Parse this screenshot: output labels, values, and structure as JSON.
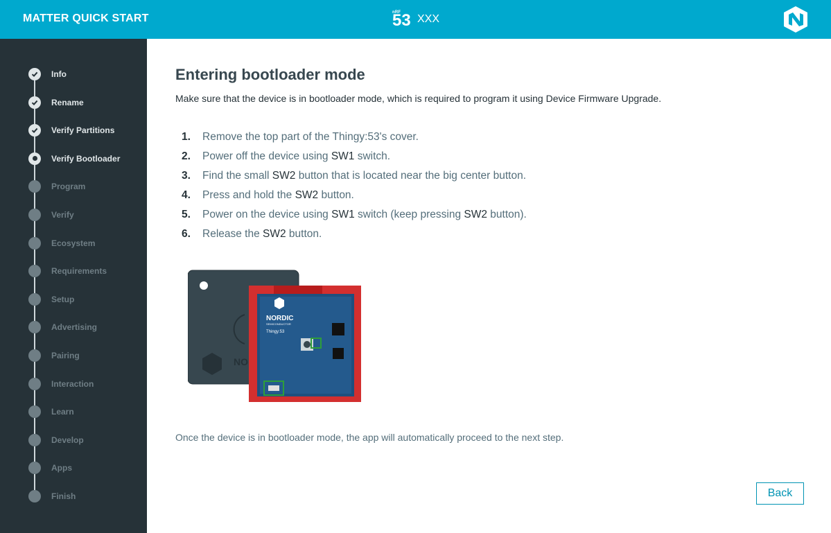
{
  "header": {
    "app_title": "MATTER QUICK START",
    "device_badge_small": "nRF",
    "device_badge_number": "53",
    "device_name": "XXX",
    "logo_icon": "nordic-logo-icon"
  },
  "sidebar": {
    "steps": [
      {
        "label": "Info",
        "state": "done"
      },
      {
        "label": "Rename",
        "state": "done"
      },
      {
        "label": "Verify Partitions",
        "state": "done"
      },
      {
        "label": "Verify Bootloader",
        "state": "active"
      },
      {
        "label": "Program",
        "state": "todo"
      },
      {
        "label": "Verify",
        "state": "todo"
      },
      {
        "label": "Ecosystem",
        "state": "todo"
      },
      {
        "label": "Requirements",
        "state": "todo"
      },
      {
        "label": "Setup",
        "state": "todo"
      },
      {
        "label": "Advertising",
        "state": "todo"
      },
      {
        "label": "Pairing",
        "state": "todo"
      },
      {
        "label": "Interaction",
        "state": "todo"
      },
      {
        "label": "Learn",
        "state": "todo"
      },
      {
        "label": "Develop",
        "state": "todo"
      },
      {
        "label": "Apps",
        "state": "todo"
      },
      {
        "label": "Finish",
        "state": "todo"
      }
    ]
  },
  "main": {
    "title": "Entering bootloader mode",
    "intro": "Make sure that the device is in bootloader mode, which is required to program it using Device Firmware Upgrade.",
    "instructions": [
      {
        "num": "1.",
        "parts": [
          {
            "t": "Remove the top part of the Thingy:53's cover.",
            "b": false
          }
        ]
      },
      {
        "num": "2.",
        "parts": [
          {
            "t": "Power off the device using ",
            "b": false
          },
          {
            "t": "SW1",
            "b": true
          },
          {
            "t": " switch.",
            "b": false
          }
        ]
      },
      {
        "num": "3.",
        "parts": [
          {
            "t": "Find the small ",
            "b": false
          },
          {
            "t": "SW2",
            "b": true
          },
          {
            "t": " button that is located near the big center button.",
            "b": false
          }
        ]
      },
      {
        "num": "4.",
        "parts": [
          {
            "t": "Press and hold the ",
            "b": false
          },
          {
            "t": "SW2",
            "b": true
          },
          {
            "t": " button.",
            "b": false
          }
        ]
      },
      {
        "num": "5.",
        "parts": [
          {
            "t": "Power on the device using ",
            "b": false
          },
          {
            "t": "SW1",
            "b": true
          },
          {
            "t": " switch (keep pressing ",
            "b": false
          },
          {
            "t": "SW2",
            "b": true
          },
          {
            "t": " button).",
            "b": false
          }
        ]
      },
      {
        "num": "6.",
        "parts": [
          {
            "t": "Release the ",
            "b": false
          },
          {
            "t": "SW2",
            "b": true
          },
          {
            "t": " button.",
            "b": false
          }
        ]
      }
    ],
    "image_text": {
      "brand": "NORDIC",
      "brand_sub": "SEMICONDUCTOR",
      "board_name": "Thingy:53",
      "case_text": "NO"
    },
    "outro": "Once the device is in bootloader mode, the app will automatically proceed to the next step.",
    "back_label": "Back"
  },
  "colors": {
    "header_bg": "#00a9ce",
    "sidebar_bg": "#263238",
    "accent": "#0093b3"
  }
}
